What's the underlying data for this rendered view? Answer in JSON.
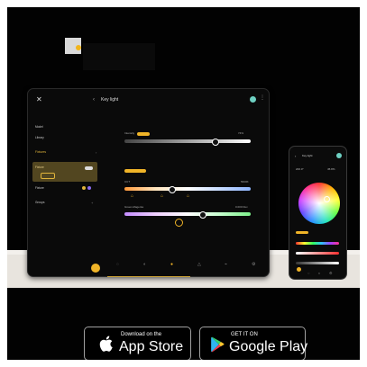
{
  "tablet": {
    "title": "Key light",
    "sidebar": {
      "items": [
        "Model",
        "Library"
      ],
      "group": "Fixtures",
      "fixtures": [
        "Fixture",
        "Fixture"
      ],
      "other": "Groups"
    },
    "sliders": [
      {
        "label": "Intensity",
        "value_text": "74%",
        "level": 0.72
      },
      {
        "label": "CCT",
        "value_text": "5600K",
        "level": 0.38
      },
      {
        "label": "Green-Magenta",
        "value_text": "0.000 Duv",
        "level": 0.62
      }
    ],
    "tabs": [
      "",
      "",
      "",
      "",
      "",
      "",
      ""
    ]
  },
  "phone": {
    "title": "Key light",
    "readouts": [
      "200.0°",
      "45.8%"
    ],
    "sliders": [
      {
        "label": "",
        "level": 0.5
      },
      {
        "label": "",
        "level": 0.55
      },
      {
        "label": "",
        "level": 0.45
      }
    ]
  },
  "store_badges": {
    "apple": {
      "small": "Download on the",
      "big": "App Store"
    },
    "google": {
      "small": "GET IT ON",
      "big": "Google Play"
    }
  },
  "colors": {
    "accent": "#f0b428",
    "power": "#6ed0c2"
  }
}
